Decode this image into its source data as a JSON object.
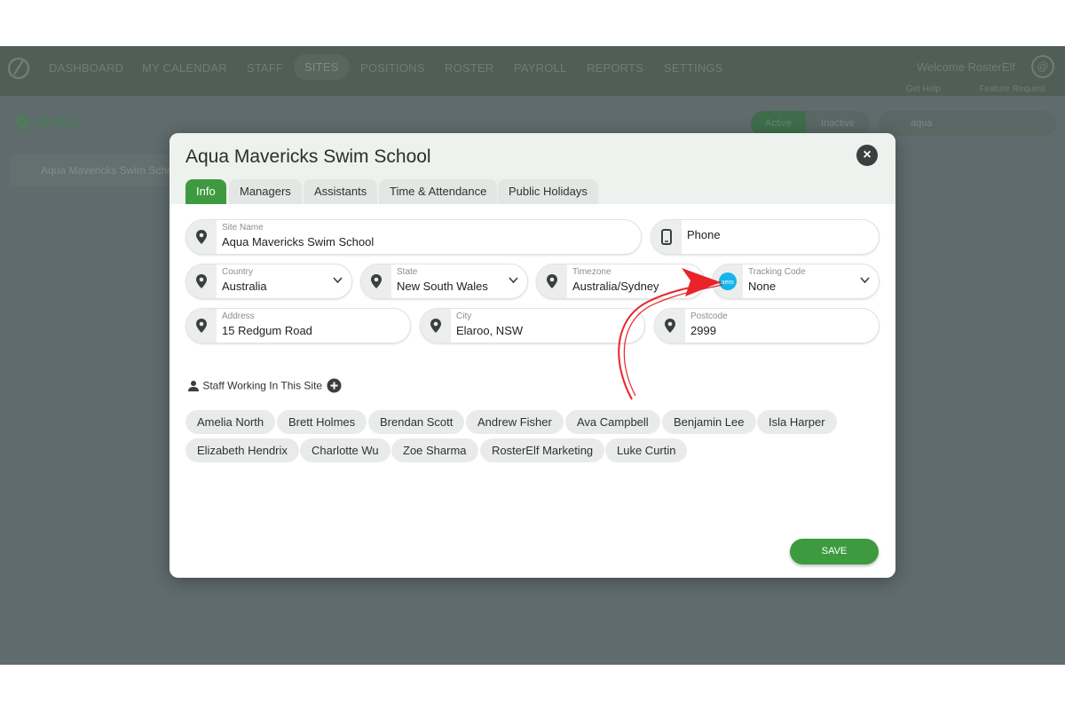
{
  "nav": {
    "items": [
      "DASHBOARD",
      "MY CALENDAR",
      "STAFF",
      "SITES",
      "POSITIONS",
      "ROSTER",
      "PAYROLL",
      "REPORTS",
      "SETTINGS"
    ],
    "welcome": "Welcome RosterElf",
    "get_help": "Get Help",
    "feature_request": "Feature Request"
  },
  "page": {
    "title": "SITES",
    "filter_active": "Active",
    "filter_inactive": "Inactive",
    "search_value": "aqua",
    "list_item": "Aqua Mavericks Swim School"
  },
  "modal": {
    "title": "Aqua Mavericks Swim School",
    "tabs": [
      "Info",
      "Managers",
      "Assistants",
      "Time & Attendance",
      "Public Holidays"
    ],
    "fields": {
      "site_name": {
        "label": "Site Name",
        "value": "Aqua Mavericks Swim School"
      },
      "phone": {
        "placeholder": "Phone"
      },
      "country": {
        "label": "Country",
        "value": "Australia"
      },
      "state": {
        "label": "State",
        "value": "New South Wales"
      },
      "timezone": {
        "label": "Timezone",
        "value": "Australia/Sydney"
      },
      "tracking_code": {
        "label": "Tracking Code",
        "value": "None",
        "badge": "xero"
      },
      "address": {
        "label": "Address",
        "value": "15 Redgum Road"
      },
      "city": {
        "label": "City",
        "value": "Elaroo, NSW"
      },
      "postcode": {
        "label": "Postcode",
        "value": "2999"
      }
    },
    "staff_heading": "Staff Working In This Site",
    "staff": [
      "Amelia North",
      "Brett Holmes",
      "Brendan Scott",
      "Andrew Fisher",
      "Ava Campbell",
      "Benjamin Lee",
      "Isla Harper",
      "Elizabeth Hendrix",
      "Charlotte Wu",
      "Zoe Sharma",
      "RosterElf Marketing",
      "Luke Curtin"
    ],
    "save_label": "SAVE"
  },
  "colors": {
    "accent": "#3e9a3f",
    "xero": "#13b5ea",
    "annotation": "#e8232a"
  }
}
